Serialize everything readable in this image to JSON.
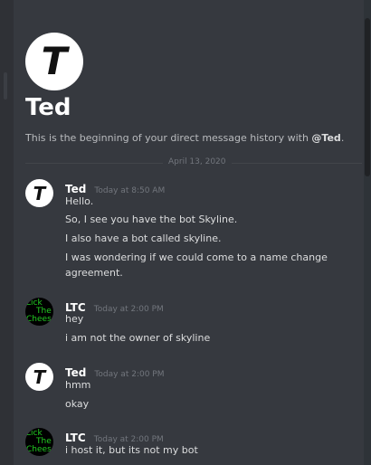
{
  "header": {
    "avatar_glyph": "T",
    "title": "Ted",
    "intro_text": "This is the beginning of your direct message history with ",
    "intro_mention": "@Ted",
    "intro_end": "."
  },
  "date_divider": "April 13, 2020",
  "messages": [
    {
      "author": "Ted",
      "timestamp": "Today at 8:50 AM",
      "lines": [
        "Hello.",
        "So, I see you have the bot Skyline.",
        "I also have a bot called skyline.",
        "I was wondering if we could come to a name change",
        "agreement."
      ]
    },
    {
      "author": "LTC",
      "timestamp": "Today at 2:00 PM",
      "lines": [
        "hey",
        "i am not the owner of skyline"
      ]
    },
    {
      "author": "Ted",
      "timestamp": "Today at 2:00 PM",
      "lines": [
        "hmm",
        "okay"
      ]
    },
    {
      "author": "LTC",
      "timestamp": "Today at 2:00 PM",
      "lines": [
        "i host it, but its not my bot"
      ]
    }
  ],
  "avatars": {
    "ted_glyph": "T",
    "ltc_text": [
      "Lick",
      "The",
      "Cheese"
    ]
  },
  "colors": {
    "background": "#36393f",
    "author": "#ffffff",
    "timestamp": "#72767d",
    "ltc_avatar_text": "#22cc22"
  }
}
